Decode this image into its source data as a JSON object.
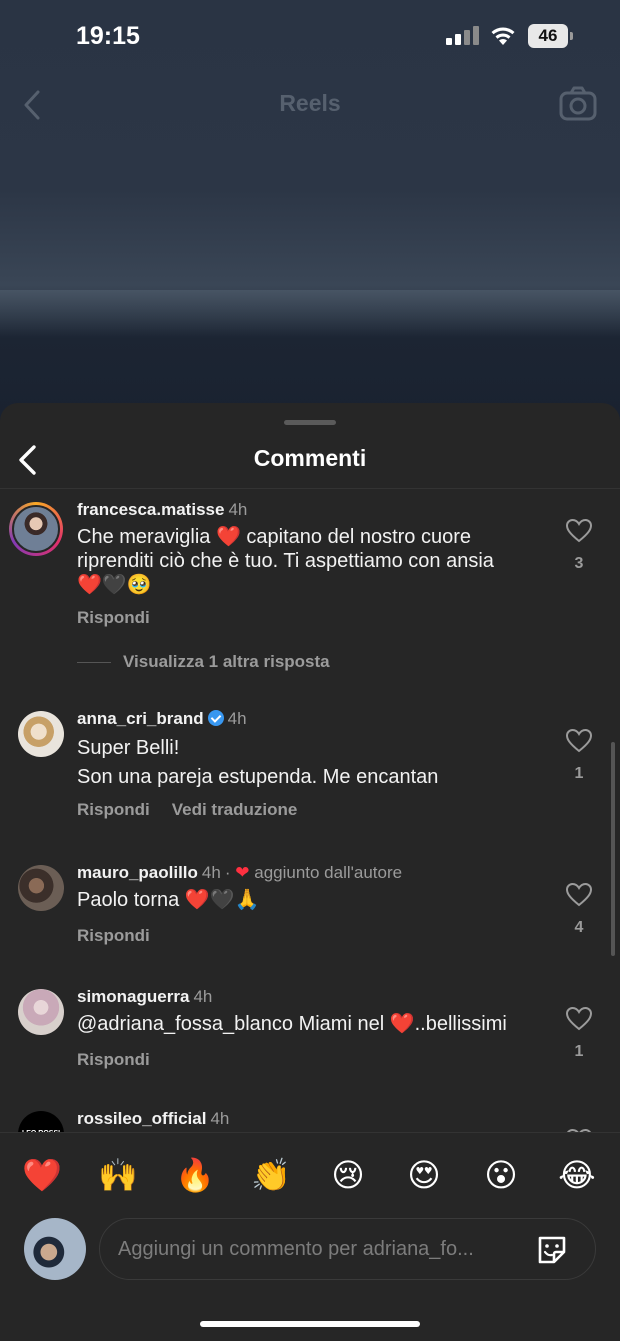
{
  "status_bar": {
    "time": "19:15",
    "battery": "46"
  },
  "reels_header": {
    "title": "Reels"
  },
  "sheet": {
    "title": "Commenti"
  },
  "comments": [
    {
      "username": "francesca.matisse",
      "time": "4h",
      "text_lines": [
        "Che meraviglia ❤️ capitano del nostro cuore",
        "riprenditi ciò che è tuo. Ti aspettiamo con ansia",
        "❤️🖤🥹"
      ],
      "reply_label": "Rispondi",
      "likes": "3",
      "view_replies": "Visualizza 1 altra risposta"
    },
    {
      "username": "anna_cri_brand",
      "verified": true,
      "time": "4h",
      "text_lines": [
        "Super Belli!",
        "Son una pareja estupenda. Me encantan"
      ],
      "reply_label": "Rispondi",
      "translate_label": "Vedi traduzione",
      "likes": "1"
    },
    {
      "username": "mauro_paolillo",
      "time": "4h",
      "author_note": "aggiunto dall'autore",
      "text_lines": [
        "Paolo torna ❤️🖤🙏"
      ],
      "reply_label": "Rispondi",
      "likes": "4"
    },
    {
      "username": "simonaguerra",
      "time": "4h",
      "text_lines": [
        "@adriana_fossa_blanco Miami nel ❤️..bellissimi"
      ],
      "reply_label": "Rispondi",
      "likes": "1"
    },
    {
      "username": "rossileo_official",
      "time": "4h",
      "avatar_text": "LEO ROSSI"
    }
  ],
  "emoji_bar": [
    "❤️",
    "🙌",
    "🔥",
    "👏",
    "😢",
    "😍",
    "😮",
    "😂"
  ],
  "composer": {
    "placeholder": "Aggiungi un commento per adriana_fo..."
  },
  "colors": {
    "sheet_bg": "#262626",
    "secondary_text": "#9b9b9b",
    "verified": "#3897f0",
    "author_heart": "#ff3040"
  },
  "icons": [
    "back-chevron-icon",
    "camera-icon",
    "heart-outline-icon",
    "sticker-icon",
    "wifi-icon",
    "signal-icon",
    "battery-icon"
  ]
}
